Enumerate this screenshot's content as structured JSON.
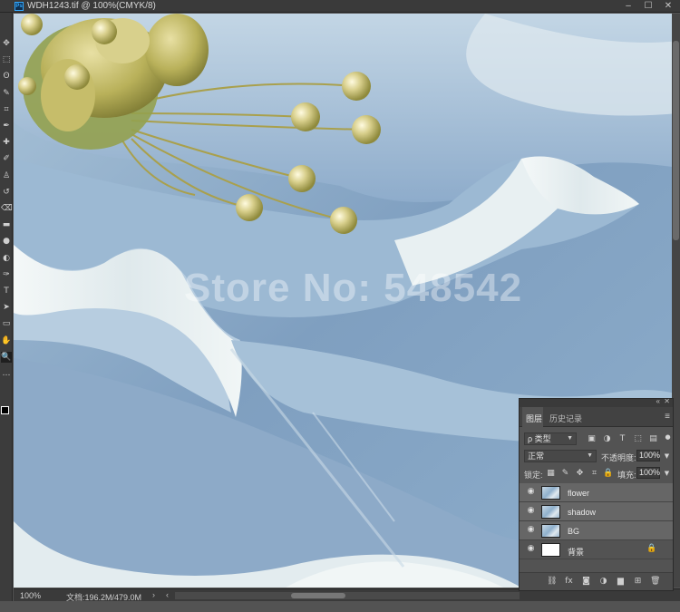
{
  "window": {
    "title": "WDH1243.tif @ 100%(CMYK/8)",
    "app_icon": "photoshop-icon",
    "buttons": {
      "minimize": "–",
      "maximize": "☐",
      "close": "✕"
    }
  },
  "toolbar": {
    "tools": [
      "move-icon",
      "marquee-icon",
      "lasso-icon",
      "quick-select-icon",
      "crop-icon",
      "eyedropper-icon",
      "healing-icon",
      "brush-icon",
      "stamp-icon",
      "history-brush-icon",
      "eraser-icon",
      "gradient-icon",
      "blur-icon",
      "dodge-icon",
      "pen-icon",
      "type-icon",
      "path-select-icon",
      "shape-icon",
      "hand-icon",
      "zoom-icon",
      "more-tools-icon"
    ],
    "glyphs": [
      "✥",
      "⬚",
      "ʘ",
      "✎",
      "⌗",
      "✒",
      "✚",
      "✐",
      "♙",
      "↺",
      "⌫",
      "▬",
      "●",
      "◐",
      "✑",
      "T",
      "➤",
      "▭",
      "✋",
      "🔍",
      "…"
    ],
    "active_tool": "zoom-icon"
  },
  "canvas": {
    "watermark": "Store No: 548542",
    "colors": {
      "petal_light": "#e9f1f3",
      "petal_blue": "#8fb2cf",
      "background_blue": "#6f95ba",
      "stamen_gold": "#c9c27a"
    }
  },
  "status": {
    "zoom": "100%",
    "doc_info": "文档:196.2M/479.0M",
    "arrow": "›",
    "scroll_left": "‹"
  },
  "layers_panel": {
    "collapse_glyph": "«",
    "close_glyph": "✕",
    "tabs": {
      "layers": "图层",
      "history": "历史记录"
    },
    "menu_glyph": "≡",
    "filter": {
      "kind_label": "ρ 类型",
      "icons": [
        "pixel-filter-icon",
        "adjustment-filter-icon",
        "type-filter-icon",
        "shape-filter-icon",
        "smart-object-filter-icon"
      ]
    },
    "blend_mode": "正常",
    "opacity_label": "不透明度:",
    "opacity_value": "100%",
    "lock_label": "锁定:",
    "fill_label": "填充:",
    "fill_value": "100%",
    "layers": [
      {
        "name": "flower",
        "visible": true,
        "selected": true,
        "thumb": "image",
        "locked": false
      },
      {
        "name": "shadow",
        "visible": true,
        "selected": true,
        "thumb": "image",
        "locked": false
      },
      {
        "name": "BG",
        "visible": true,
        "selected": true,
        "thumb": "image",
        "locked": false
      },
      {
        "name": "背景",
        "visible": true,
        "selected": false,
        "thumb": "white",
        "locked": true
      }
    ],
    "footer_icons": [
      "link-layers-icon",
      "fx-icon",
      "add-mask-icon",
      "adjustment-layer-icon",
      "new-group-icon",
      "new-layer-icon",
      "delete-layer-icon"
    ],
    "footer_glyphs": [
      "⛓",
      "fx",
      "◙",
      "◑",
      "▆",
      "⊞",
      "🗑"
    ]
  }
}
